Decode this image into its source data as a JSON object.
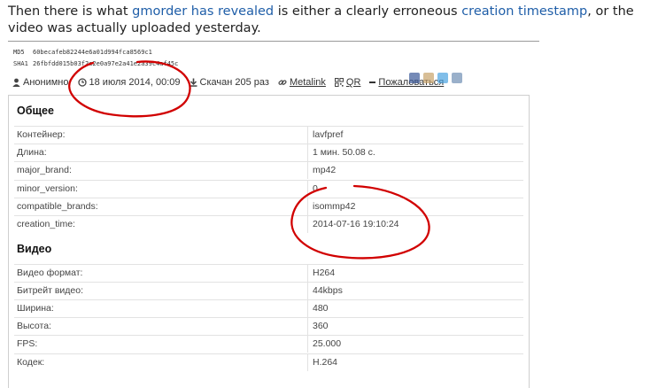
{
  "intro": {
    "pre": "Then there is what ",
    "link1": "gmorder has revealed",
    "mid": " is either a clearly erroneous ",
    "link2": "creation timestamp",
    "post": ", or the video was actually uploaded yesterday."
  },
  "hashes": {
    "md5_label": "MD5",
    "md5_value": "60becafeb82244e6a01d994fca8569c1",
    "sha1_label": "SHA1",
    "sha1_value": "26fbfdd015b03f2e2e0a97e2a41e2a39c4af45c"
  },
  "meta": {
    "user": "Анонимно",
    "date": "18 июля 2014, 00:09",
    "downloads": "Скачан 205 раз",
    "metalink": "Metalink",
    "qr": "QR",
    "complain": "Пожаловаться"
  },
  "icons": [
    "user-icon",
    "clock-icon",
    "download-icon",
    "link-icon",
    "qr-icon",
    "dash-icon",
    "facebook-icon",
    "vkontakte-icon",
    "twitter-icon",
    "blogger-icon"
  ],
  "colors": {
    "link": "#1f5ea8",
    "annotation": "#d10000"
  },
  "sections": {
    "general": {
      "title": "Общее",
      "rows": [
        {
          "label": "Контейнер:",
          "value": "lavfpref"
        },
        {
          "label": "Длина:",
          "value": "1 мин. 50.08 с."
        },
        {
          "label": "major_brand:",
          "value": "mp42"
        },
        {
          "label": "minor_version:",
          "value": "0"
        },
        {
          "label": "compatible_brands:",
          "value": "isommp42"
        },
        {
          "label": "creation_time:",
          "value": "2014-07-16 19:10:24"
        }
      ]
    },
    "video": {
      "title": "Видео",
      "rows": [
        {
          "label": "Видео формат:",
          "value": "H264"
        },
        {
          "label": "Битрейт видео:",
          "value": "44kbps"
        },
        {
          "label": "Ширина:",
          "value": "480"
        },
        {
          "label": "Высота:",
          "value": "360"
        },
        {
          "label": "FPS:",
          "value": "25.000"
        },
        {
          "label": "Кодек:",
          "value": "H.264"
        }
      ]
    }
  }
}
